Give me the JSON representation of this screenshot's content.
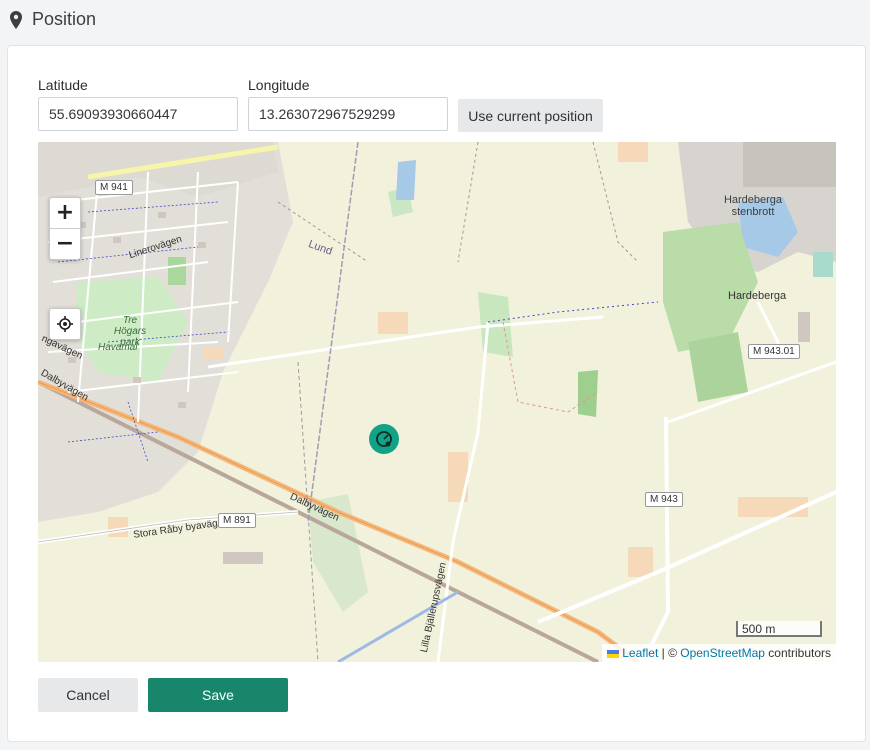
{
  "header": {
    "title": "Position",
    "icon": "map-pin-icon"
  },
  "form": {
    "latitude_label": "Latitude",
    "latitude_value": "55.69093930660447",
    "longitude_label": "Longitude",
    "longitude_value": "13.263072967529299",
    "use_current_label": "Use current position"
  },
  "map": {
    "zoom_in": "+",
    "zoom_out": "−",
    "scale": "500 m",
    "attribution": {
      "leaflet": "Leaflet",
      "sep": " | © ",
      "osm": "OpenStreetMap",
      "suffix": " contributors"
    },
    "labels": {
      "m941": "M 941",
      "lund": "Lund",
      "linerovagen": "Linerovägen",
      "tre_hogars_park": "Tre Högars park",
      "havamal": "Havamal",
      "dalbyvagen_w": "Dalbyvägen",
      "gavagen": "ngavägen",
      "hardeberga_stenbrott": "Hardeberga stenbrott",
      "hardeberga": "Hardeberga",
      "m943_01": "M 943.01",
      "m943": "M 943",
      "m891": "M 891",
      "stora_raby": "Stora Råby byaväg",
      "dalbyvagen": "Dalbyvägen",
      "lilla_bjallerup": "Lilla Bjällerupsvägen"
    },
    "colors": {
      "marker": "#12a386",
      "link": "#0078a8"
    }
  },
  "actions": {
    "cancel_label": "Cancel",
    "save_label": "Save"
  },
  "colors": {
    "save_button": "#17866b",
    "cancel_button": "#e7e8ea"
  }
}
